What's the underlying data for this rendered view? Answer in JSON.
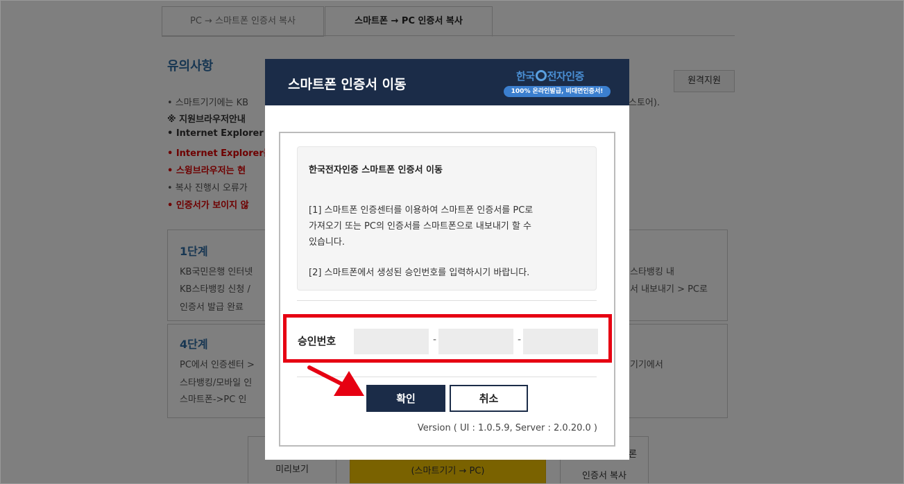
{
  "background": {
    "tabs": [
      "PC → 스마트폰 인증서 복사",
      "스마트폰 → PC 인증서 복사"
    ],
    "notice_title": "유의사항",
    "remote_button": "원격지원",
    "notes": [
      "• 스마트기기에는 KB",
      "※ 지원브라우저안내",
      "• Internet Explorer /",
      "• Internet Explorer는",
      "• 스윙브라우저는 현",
      "• 복사 진행시 오류가",
      "• 인증서가 보이지 않"
    ],
    "note_right": "스토어).",
    "step1": {
      "title": "1단계",
      "lines": [
        "KB국민은행 인터넷",
        "KB스타뱅킹 신청 /",
        "인증서 발급 완료"
      ],
      "right_lines": [
        "스타뱅킹 내",
        "서 내보내기 > PC로"
      ]
    },
    "step4": {
      "title": "4단계",
      "lines": [
        "PC에서 인증센터 >",
        "스타뱅킹/모바일 인",
        "스마트폰->PC 인"
      ],
      "right_lines": [
        "기기에서"
      ]
    },
    "bottom_buttons": [
      "미리보기",
      "(스마트기기 → PC)",
      "인증서 복사"
    ],
    "bottom_right_top": "론"
  },
  "modal": {
    "title": "스마트폰 인증서 이동",
    "logo_text_a": "한국",
    "logo_text_b": "전자인증",
    "logo_badge": "100% 온라인발급, 비대면인증서!",
    "info_title": "한국전자인증 스마트폰 인증서 이동",
    "info_lines": [
      "[1] 스마트폰 인증센터를 이용하여 스마트폰 인증서를 PC로",
      "가져오기 또는 PC의 인증서를 스마트폰으로 내보내기 할 수",
      "있습니다.",
      "[2] 스마트폰에서 생성된 승인번호를 입력하시기 바랍니다."
    ],
    "approval_label": "승인번호",
    "code_values": [
      "",
      "",
      ""
    ],
    "dash": "-",
    "confirm": "확인",
    "cancel": "취소",
    "version": "Version ( UI : 1.0.5.9, Server : 2.0.20.0 )"
  },
  "colors": {
    "modal_header": "#1b2c48",
    "highlight": "#e60012",
    "notice_blue": "#2e6da4",
    "warning_red": "#d00000",
    "yellow_button": "#f5c400"
  }
}
